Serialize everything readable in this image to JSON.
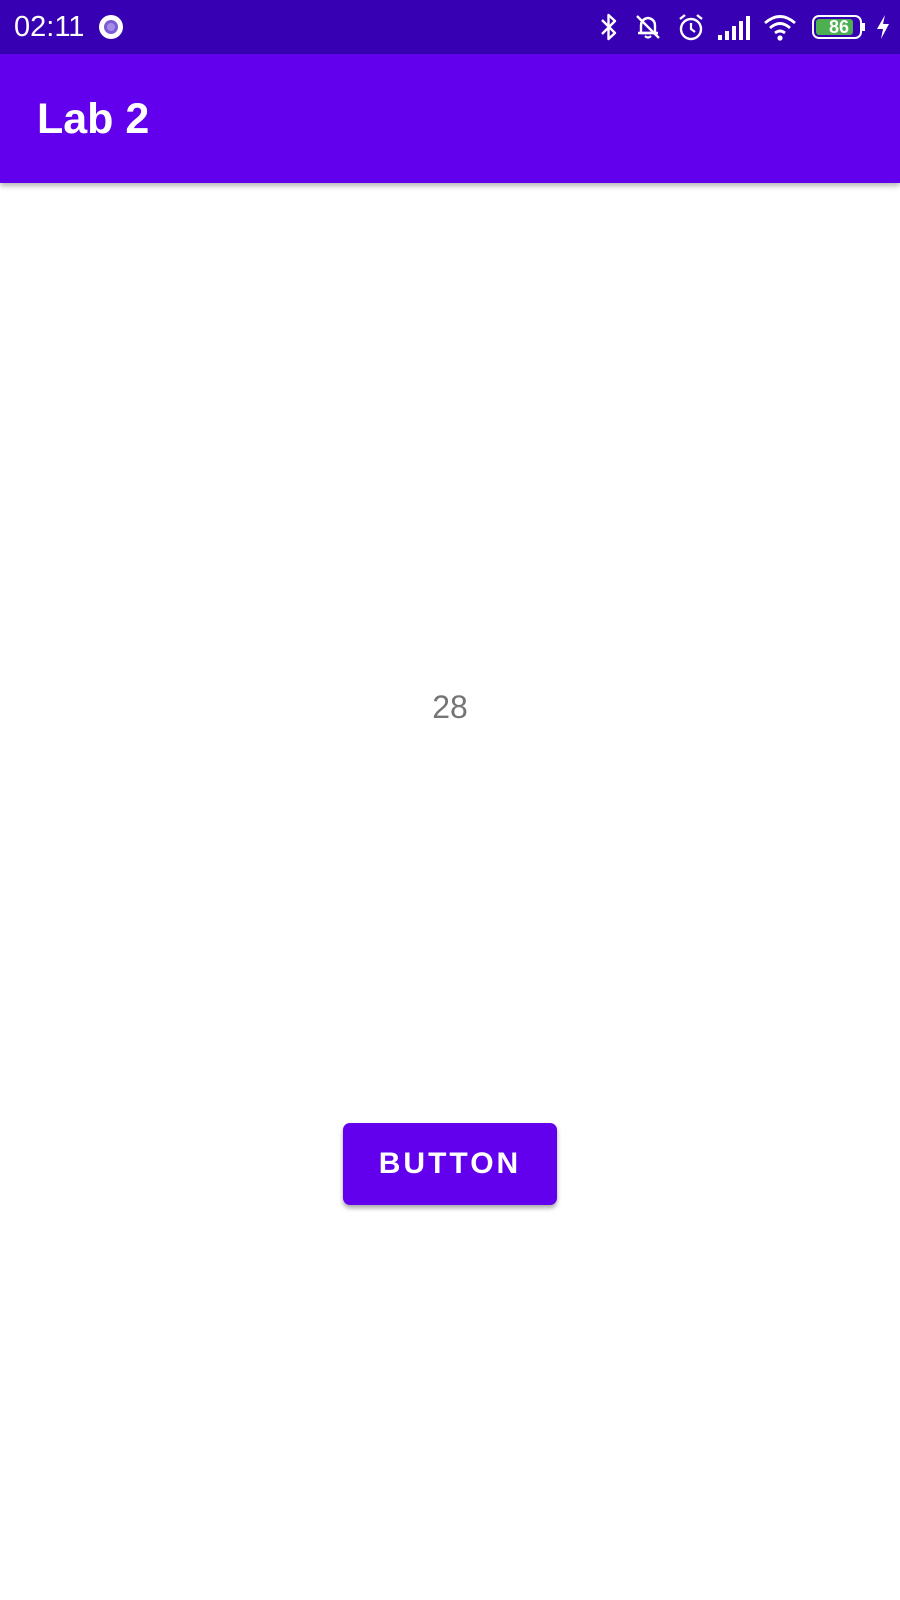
{
  "status_bar": {
    "time": "02:11",
    "battery_level": "86",
    "icons": [
      "app-notification-icon",
      "bluetooth-icon",
      "silent-mode-icon",
      "alarm-icon",
      "cell-signal-icon",
      "wifi-icon",
      "battery-icon",
      "charging-icon"
    ],
    "background_color": "#3700b3"
  },
  "app_bar": {
    "title": "Lab 2",
    "background_color": "#6200ee"
  },
  "main": {
    "counter_value": "28",
    "button_label": "BUTTON",
    "button_color": "#6200ee"
  }
}
